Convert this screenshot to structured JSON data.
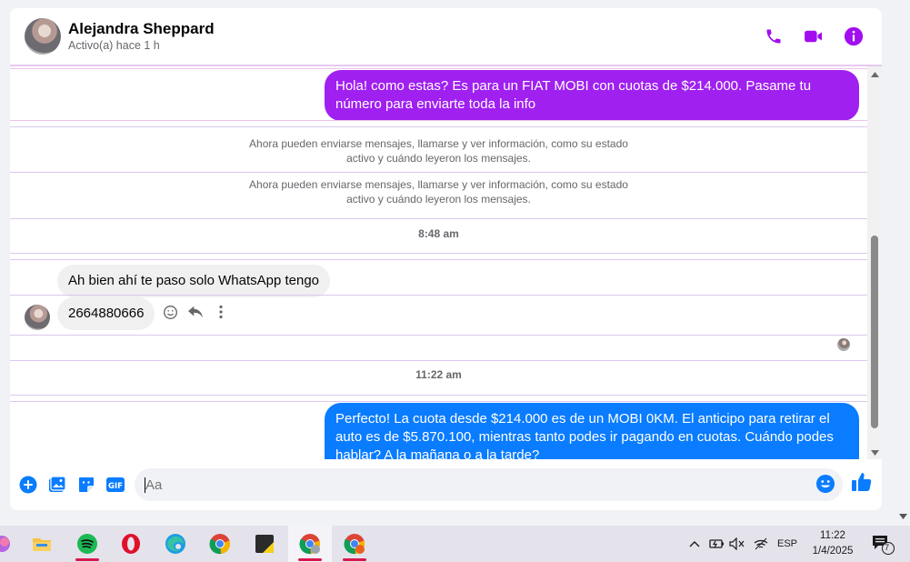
{
  "header": {
    "name": "Alejandra Sheppard",
    "status": "Activo(a) hace 1 h"
  },
  "messages": {
    "outgoing_1": "Hola! como estas? Es para un FIAT MOBI con cuotas de $214.000. Pasame tu número para enviarte toda la info",
    "system_note_1": "Ahora pueden enviarse mensajes, llamarse y ver información, como su estado activo y cuándo leyeron los mensajes.",
    "system_note_2": "Ahora pueden enviarse mensajes, llamarse y ver información, como su estado activo y cuándo leyeron los mensajes.",
    "time_1": "8:48 am",
    "incoming_1": "Ah bien ahí te paso solo WhatsApp tengo",
    "incoming_2": "2664880666",
    "time_2": "11:22 am",
    "outgoing_2": "Perfecto! La cuota desde $214.000 es de un MOBI 0KM. El anticipo para retirar el auto es de $5.870.100, mientras tanto podes ir pagando en cuotas. Cuándo podes hablar? A la mañana o a la tarde?"
  },
  "composer": {
    "placeholder": "Aa"
  },
  "taskbar": {
    "language": "ESP",
    "time": "11:22",
    "date": "1/4/2025",
    "notification_count": "7"
  },
  "colors": {
    "accent_purple": "#a020f0",
    "messenger_blue": "#0a7cff",
    "header_icon_purple": "#a10ef0"
  }
}
